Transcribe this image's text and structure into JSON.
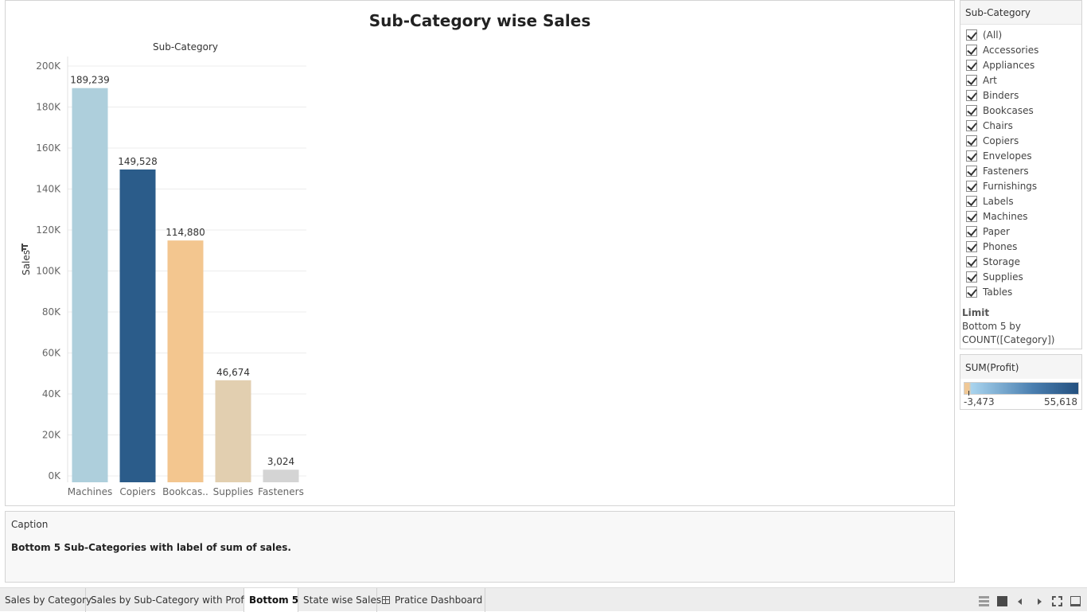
{
  "sheet_title": "Sub-Category wise Sales",
  "chart_data": {
    "type": "bar",
    "title": "Sub-Category wise Sales",
    "header": "Sub-Category",
    "ylabel": "Sales",
    "categories": [
      "Machines",
      "Copiers",
      "Bookcas..",
      "Supplies",
      "Fasteners"
    ],
    "values": [
      189239,
      149528,
      114880,
      46674,
      3024
    ],
    "value_labels": [
      "189,239",
      "149,528",
      "114,880",
      "46,674",
      "3,024"
    ],
    "bar_colors": [
      "#aecfdc",
      "#2b5c8a",
      "#f3c68f",
      "#e2cfb0",
      "#d4d4d4"
    ],
    "yticks": [
      0,
      20000,
      40000,
      60000,
      80000,
      100000,
      120000,
      140000,
      160000,
      180000,
      200000
    ],
    "ytick_labels": [
      "0K",
      "20K",
      "40K",
      "60K",
      "80K",
      "100K",
      "120K",
      "140K",
      "160K",
      "180K",
      "200K"
    ],
    "ylim": [
      0,
      200000
    ],
    "grid": true
  },
  "filter": {
    "title": "Sub-Category",
    "items": [
      "(All)",
      "Accessories",
      "Appliances",
      "Art",
      "Binders",
      "Bookcases",
      "Chairs",
      "Copiers",
      "Envelopes",
      "Fasteners",
      "Furnishings",
      "Labels",
      "Machines",
      "Paper",
      "Phones",
      "Storage",
      "Supplies",
      "Tables"
    ],
    "limit_title": "Limit",
    "limit_line1": "Bottom 5 by",
    "limit_line2": "COUNT([Category])"
  },
  "legend": {
    "title": "SUM(Profit)",
    "min": "-3,473",
    "max": "55,618",
    "color_low": "#f0c896",
    "color_high": "#24507f"
  },
  "caption": {
    "title": "Caption",
    "text": "Bottom 5 Sub-Categories with label of sum of sales."
  },
  "tabs": {
    "t1": "Sales by Category",
    "t2": "Sales by Sub-Category with Profit",
    "t3": "Bottom 5",
    "t4": "State wise Sales",
    "t5": "Pratice Dashboard"
  }
}
